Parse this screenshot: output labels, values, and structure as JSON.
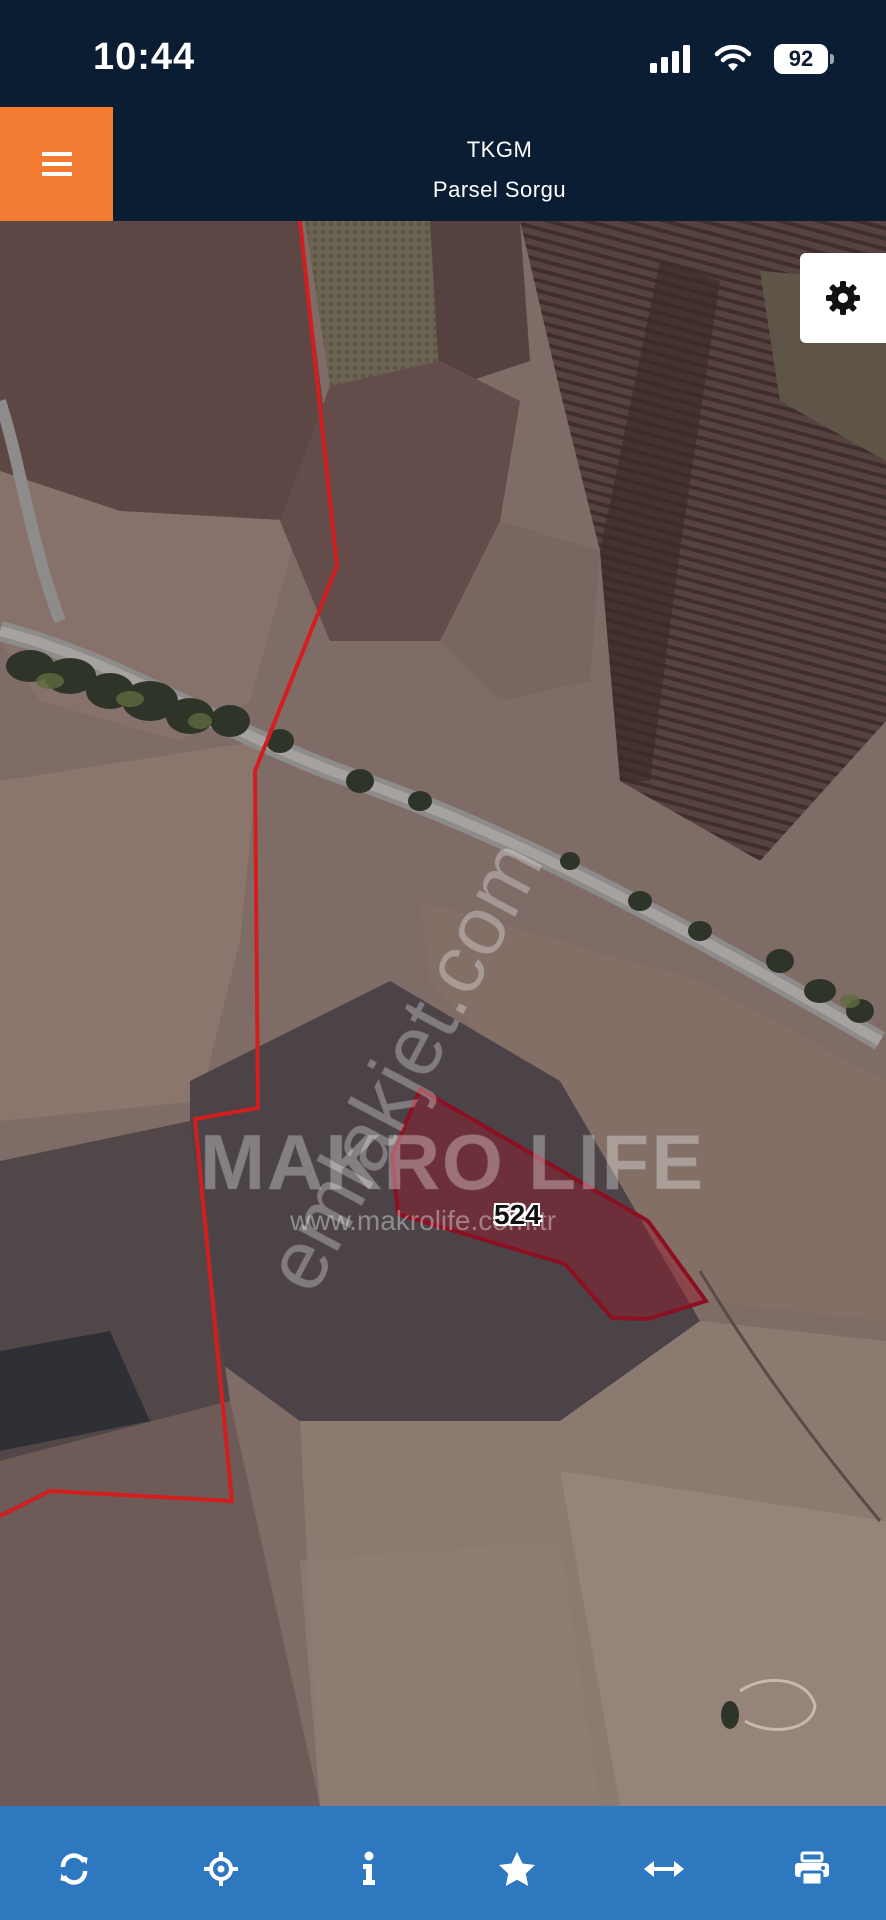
{
  "status_bar": {
    "time": "10:44",
    "battery": "92",
    "icons": [
      "signal-icon",
      "wifi-icon",
      "battery-icon"
    ]
  },
  "header": {
    "title": "TKGM",
    "subtitle": "Parsel Sorgu",
    "menu_icon": "hamburger-menu-icon",
    "accent_color": "#f47b32",
    "background_color": "#0b1d33"
  },
  "map": {
    "parcel_number": "524",
    "settings_icon": "gear-icon",
    "watermark_brand": "MAKRO LIFE",
    "watermark_url": "www.makrolife.com.tr",
    "watermark_site": "emlakjet.com",
    "parcel_outline_color": "#8b1022",
    "boundary_color": "#d21e1e"
  },
  "toolbar": {
    "background_color": "#2e78bf",
    "items": [
      "refresh-icon",
      "locate-icon",
      "info-icon",
      "favorite-star-icon",
      "measure-icon",
      "print-icon"
    ]
  }
}
